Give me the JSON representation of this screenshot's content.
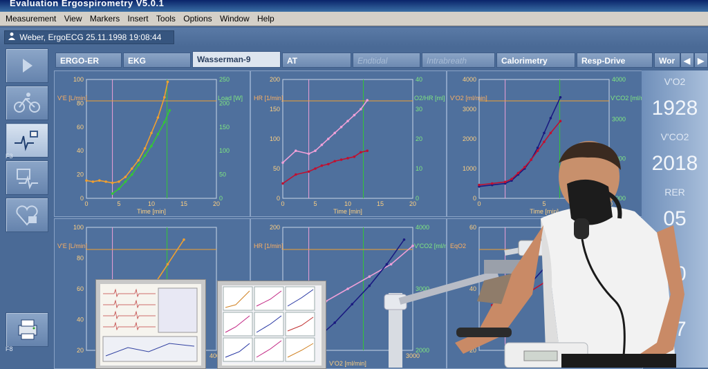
{
  "window": {
    "title": "Evaluation Ergospirometry V5.0.1"
  },
  "menu": {
    "items": [
      "Measurement",
      "View",
      "Markers",
      "Insert",
      "Tools",
      "Options",
      "Window",
      "Help"
    ]
  },
  "patient": {
    "label": "Weber, ErgoECG",
    "datetime": "25.11.1998 19:08:44"
  },
  "sidebar": {
    "labels": [
      "F3",
      "F8"
    ]
  },
  "tabs": [
    {
      "label": "ERGO-ER",
      "state": "normal"
    },
    {
      "label": "EKG",
      "state": "normal"
    },
    {
      "label": "Wasserman-9",
      "state": "active"
    },
    {
      "label": "AT",
      "state": "normal"
    },
    {
      "label": "Endtidal",
      "state": "disabled"
    },
    {
      "label": "Intrabreath",
      "state": "disabled"
    },
    {
      "label": "Calorimetry",
      "state": "normal"
    },
    {
      "label": "Resp-Drive",
      "state": "normal"
    },
    {
      "label": "Wor",
      "state": "normal"
    }
  ],
  "readouts": [
    {
      "label": "V'O2",
      "value": "1928"
    },
    {
      "label": "V'CO2",
      "value": "2018"
    },
    {
      "label": "RER",
      "value": "05"
    },
    {
      "label": "",
      "value": "50"
    },
    {
      "label": "",
      "value": "27"
    }
  ],
  "colors": {
    "orange": "#f0a030",
    "green": "#34c834",
    "pink": "#f0a0d8",
    "darkred": "#c01030",
    "navy": "#1a1a80",
    "panel": "#4f709d"
  },
  "chart_data": [
    {
      "type": "scatter",
      "title": "",
      "xlabel": "Time [min]",
      "ylabel": "V'E [L/min]",
      "y2label": "Load [W]",
      "xlim": [
        0,
        20
      ],
      "ylim": [
        0,
        100
      ],
      "y2lim": [
        0,
        250
      ],
      "xticks": [
        "0",
        "5",
        "10",
        "15",
        "20"
      ],
      "yticks": [
        "0",
        "20",
        "40",
        "60",
        "80",
        "100"
      ],
      "y2ticks": [
        "0",
        "50",
        "100",
        "150",
        "200",
        "250"
      ],
      "series": [
        {
          "color": "orange",
          "x": [
            0,
            1,
            2,
            3,
            4,
            5,
            6,
            7,
            8,
            9,
            10,
            11,
            12,
            12.5
          ],
          "y": [
            15,
            14,
            15,
            14,
            13,
            14,
            18,
            25,
            32,
            42,
            55,
            68,
            85,
            98
          ]
        },
        {
          "color": "green",
          "x": [
            4,
            5,
            6,
            7,
            8,
            9,
            10,
            11,
            12,
            12.8
          ],
          "y": [
            10,
            20,
            35,
            50,
            70,
            90,
            110,
            135,
            160,
            185
          ]
        }
      ]
    },
    {
      "type": "scatter",
      "title": "",
      "xlabel": "Time [min]",
      "ylabel": "HR [1/min]",
      "y2label": "O2/HR [ml]",
      "xlim": [
        0,
        20
      ],
      "ylim": [
        0,
        200
      ],
      "y2lim": [
        0,
        40
      ],
      "xticks": [
        "0",
        "5",
        "10",
        "15",
        "20"
      ],
      "yticks": [
        "0",
        "50",
        "100",
        "150",
        "200"
      ],
      "y2ticks": [
        "0",
        "10",
        "20",
        "30",
        "40"
      ],
      "series": [
        {
          "color": "pink",
          "x": [
            0,
            2,
            4,
            5,
            6,
            7,
            8,
            9,
            10,
            11,
            12,
            13
          ],
          "y": [
            60,
            80,
            75,
            80,
            90,
            100,
            110,
            120,
            130,
            140,
            150,
            165
          ]
        },
        {
          "color": "darkred",
          "x": [
            0,
            2,
            4,
            5,
            6,
            7,
            8,
            9,
            10,
            11,
            12,
            13
          ],
          "y": [
            5,
            8,
            9,
            10,
            11,
            11.5,
            12.5,
            13,
            13.5,
            14,
            15.5,
            16
          ]
        }
      ]
    },
    {
      "type": "scatter",
      "title": "",
      "xlabel": "Time [min]",
      "ylabel": "V'O2 [ml/min]",
      "y2label": "V'CO2 [ml/min]",
      "xlim": [
        0,
        20
      ],
      "ylim": [
        0,
        4000
      ],
      "y2lim": [
        0,
        4000
      ],
      "xticks": [
        "0",
        "5",
        "10"
      ],
      "yticks": [
        "0",
        "1000",
        "2000",
        "3000",
        "4000"
      ],
      "y2ticks": [
        "1000",
        "2000",
        "3000",
        "4000"
      ],
      "series": [
        {
          "color": "navy",
          "x": [
            0,
            2,
            4,
            5,
            6,
            7,
            8,
            9,
            10,
            11,
            12.5
          ],
          "y": [
            400,
            450,
            500,
            600,
            800,
            1000,
            1300,
            1700,
            2200,
            2700,
            3400
          ]
        },
        {
          "color": "darkred",
          "x": [
            0,
            2,
            4,
            5,
            6,
            7,
            8,
            9,
            10,
            11,
            12.5
          ],
          "y": [
            450,
            500,
            550,
            650,
            850,
            1050,
            1300,
            1600,
            1900,
            2200,
            2600
          ]
        }
      ]
    },
    {
      "type": "scatter",
      "title": "",
      "xlabel": "",
      "ylabel": "V'E [L/min]",
      "xlim": [
        0,
        4000
      ],
      "ylim": [
        0,
        100
      ],
      "xticks": [
        "4000"
      ],
      "yticks": [
        "20",
        "40",
        "60",
        "80",
        "100"
      ],
      "series": [
        {
          "color": "orange",
          "x": [
            1500,
            2000,
            2500,
            3000
          ],
          "y": [
            30,
            50,
            70,
            90
          ]
        }
      ]
    },
    {
      "type": "scatter",
      "title": "",
      "xlabel": "V'O2 [ml/min]",
      "ylabel": "HR [1/min]",
      "y2label": "V'CO2 [ml/min]",
      "xlim": [
        0,
        3000
      ],
      "ylim": [
        0,
        200
      ],
      "y2lim": [
        0,
        4000
      ],
      "xticks": [
        "2000",
        "3000"
      ],
      "yticks": [
        "100",
        "150",
        "200"
      ],
      "y2ticks": [
        "2000",
        "3000",
        "4000"
      ],
      "series": [
        {
          "color": "pink",
          "x": [
            500,
            1000,
            1500,
            2000,
            2500,
            3000
          ],
          "y": [
            60,
            80,
            100,
            120,
            140,
            170
          ]
        },
        {
          "color": "navy",
          "x": [
            800,
            1200,
            1600,
            2000,
            2400,
            2800
          ],
          "y": [
            400,
            900,
            1500,
            2100,
            2800,
            3600
          ]
        }
      ]
    },
    {
      "type": "scatter",
      "title": "",
      "xlabel": "",
      "ylabel": "EqO2",
      "xlim": [
        0,
        20
      ],
      "ylim": [
        0,
        60
      ],
      "xticks": [],
      "yticks": [
        "20",
        "40",
        "60"
      ],
      "series": [
        {
          "color": "navy",
          "x": [
            2,
            4,
            6,
            8,
            10
          ],
          "y": [
            25,
            27,
            30,
            33,
            40
          ]
        },
        {
          "color": "darkred",
          "x": [
            2,
            4,
            6,
            8,
            10
          ],
          "y": [
            22,
            24,
            26,
            29,
            33
          ]
        }
      ]
    }
  ]
}
